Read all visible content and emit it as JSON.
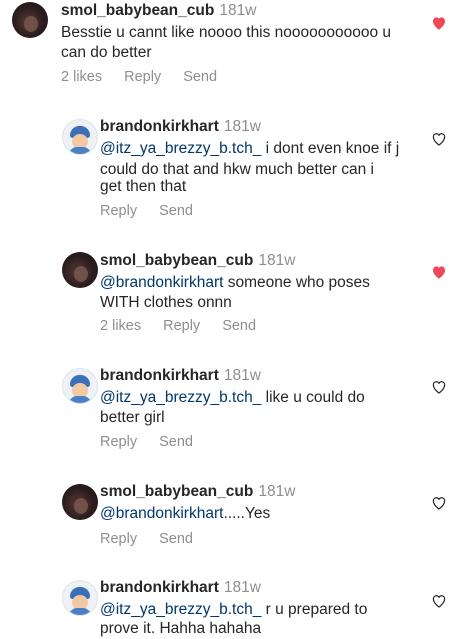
{
  "comments": [
    {
      "username": "smol_babybean_cub",
      "time": "181w",
      "lines": [
        "Besstie u cannt like noooo this nooooooooooo u",
        "can do better"
      ],
      "likes": "2 likes",
      "reply": "Reply",
      "send": "Send",
      "liked": true
    },
    {
      "username": "brandonkirkhart",
      "time": "181w",
      "mention": "@itz_ya_brezzy_b.tch_",
      "lines": [
        " i dont even knoe if j",
        "could do that and hkw much better can i",
        "get then that"
      ],
      "reply": "Reply",
      "send": "Send",
      "liked": false
    },
    {
      "username": "smol_babybean_cub",
      "time": "181w",
      "mention": "@brandonkirkhart",
      "lines": "  someone who poses|WITH clothes onnn",
      "lines_arr": [
        "  someone who poses",
        "WITH clothes onnn"
      ],
      "likes": "2 likes",
      "reply": "Reply",
      "send": "Send",
      "liked": true
    },
    {
      "username": "brandonkirkhart",
      "time": "181w",
      "mention": "@itz_ya_brezzy_b.tch_",
      "lines_arr": [
        " like u could do",
        "better girl"
      ],
      "reply": "Reply",
      "send": "Send",
      "liked": false
    },
    {
      "username": "smol_babybean_cub",
      "time": "181w",
      "mention": "@brandonkirkhart",
      "lines_arr": [
        ".....Yes"
      ],
      "reply": "Reply",
      "send": "Send",
      "liked": false
    },
    {
      "username": "brandonkirkhart",
      "time": "181w",
      "mention": "@itz_ya_brezzy_b.tch_",
      "lines_arr": [
        " r u prepared to",
        "prove it. Hahha hahaha"
      ],
      "liked": false
    }
  ],
  "colors": {
    "heart_liked": "#ed4956",
    "heart_outline": "#8e8e8e",
    "mention": "#00376b",
    "muted": "#8e8e8e"
  }
}
